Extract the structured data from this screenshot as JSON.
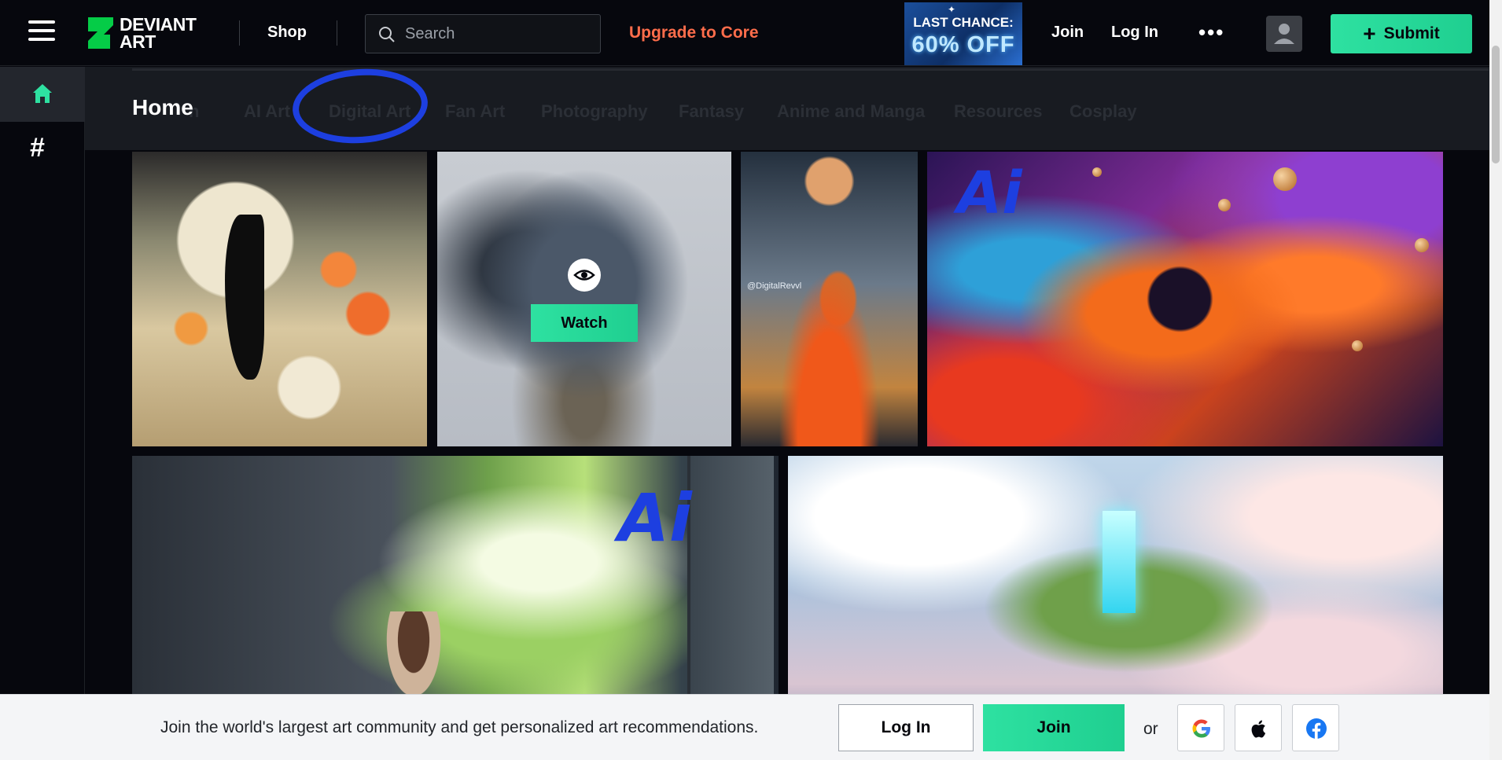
{
  "header": {
    "logo_line1": "DEVIANT",
    "logo_line2": "ART",
    "shop_label": "Shop",
    "search_placeholder": "Search",
    "upgrade_label": "Upgrade to Core",
    "promo_line1": "LAST CHANCE:",
    "promo_line2": "60% OFF",
    "join_label": "Join",
    "login_label": "Log In",
    "more_label": "•••",
    "submit_label": "Submit",
    "accent_color": "#2ee1a1",
    "upgrade_color": "#ff6d4b"
  },
  "sidebar": {
    "items": [
      {
        "icon": "home-icon",
        "active": true
      },
      {
        "icon": "hashtag-icon",
        "label": "#"
      }
    ]
  },
  "categories": {
    "home_label": "Home",
    "items": [
      "AI Art",
      "Digital Art",
      "Fan Art",
      "Photography",
      "Fantasy",
      "Anime and Manga",
      "Resources",
      "Cosplay"
    ],
    "partial_label": "n"
  },
  "gallery": {
    "watch_label": "Watch",
    "artist_tag": "@DigitalRevvl",
    "annotation_text": "Ai"
  },
  "banner": {
    "message": "Join the world's largest art community and get personalized art recommendations.",
    "login_label": "Log In",
    "join_label": "Join",
    "or_label": "or",
    "social": [
      "google-icon",
      "apple-icon",
      "facebook-icon"
    ]
  }
}
